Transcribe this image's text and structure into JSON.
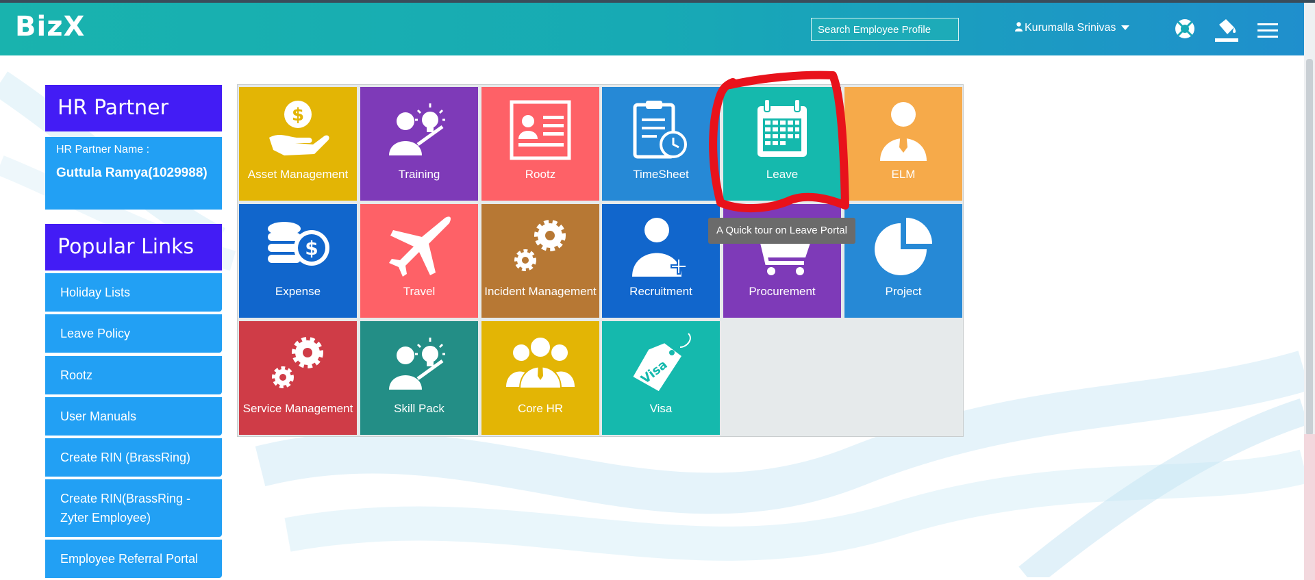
{
  "header": {
    "logo": "BizX",
    "search_placeholder": "Search Employee Profile",
    "user_name": "Kurumalla Srinivas",
    "icons": [
      "lifebuoy-icon",
      "paint-bucket-icon",
      "menu-icon"
    ]
  },
  "sidebar": {
    "partner_title": "HR Partner",
    "partner_label": "HR Partner Name :",
    "partner_name": "Guttula Ramya(1029988)",
    "links_title": "Popular Links",
    "links": [
      "Holiday Lists",
      "Leave Policy",
      "Rootz",
      "User Manuals",
      "Create RIN (BrassRing)",
      "Create RIN(BrassRing - Zyter Employee)",
      "Employee Referral Portal"
    ]
  },
  "tiles": [
    {
      "label": "Asset Management",
      "color": "#e3b505",
      "icon": "money-hand-icon"
    },
    {
      "label": "Training",
      "color": "#7e3ab8",
      "icon": "trainer-idea-icon"
    },
    {
      "label": "Rootz",
      "color": "#fe6167",
      "icon": "id-card-icon"
    },
    {
      "label": "TimeSheet",
      "color": "#2689d6",
      "icon": "clipboard-clock-icon"
    },
    {
      "label": "Leave",
      "color": "#15b9ad",
      "icon": "calendar-icon"
    },
    {
      "label": "ELM",
      "color": "#f6aa4a",
      "icon": "person-tie-icon"
    },
    {
      "label": "Expense",
      "color": "#1166cc",
      "icon": "coins-dollar-icon"
    },
    {
      "label": "Travel",
      "color": "#fe6167",
      "icon": "airplane-icon"
    },
    {
      "label": "Incident Management",
      "color": "#b77834",
      "icon": "gears-icon"
    },
    {
      "label": "Recruitment",
      "color": "#1166cc",
      "icon": "add-user-icon"
    },
    {
      "label": "Procurement",
      "color": "#7e3ab8",
      "icon": "shopping-cart-icon"
    },
    {
      "label": "Project",
      "color": "#2689d6",
      "icon": "pie-chart-icon"
    },
    {
      "label": "Service Management",
      "color": "#cf3c47",
      "icon": "gears-icon"
    },
    {
      "label": "Skill Pack",
      "color": "#238e86",
      "icon": "trainer-idea-icon"
    },
    {
      "label": "Core HR",
      "color": "#e3b505",
      "icon": "group-icon"
    },
    {
      "label": "Visa",
      "color": "#15b9ad",
      "icon": "visa-tag-icon"
    }
  ],
  "tooltip": "A Quick tour on Leave Portal",
  "highlighted_tile": "Leave",
  "highlight_color": "#e8121b"
}
